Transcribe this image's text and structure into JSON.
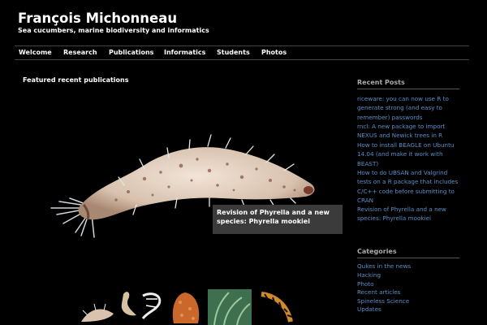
{
  "site": {
    "title": "François Michonneau",
    "tagline": "Sea cucumbers, marine biodiversity and informatics"
  },
  "nav": {
    "items": [
      {
        "label": "Welcome"
      },
      {
        "label": "Research"
      },
      {
        "label": "Publications"
      },
      {
        "label": "Informatics"
      },
      {
        "label": "Students"
      },
      {
        "label": "Photos"
      }
    ]
  },
  "featured": {
    "heading": "Featured recent publications",
    "caption": "Revision of Phyrella and a new species: Phyrella mookiei"
  },
  "sidebar": {
    "recent_posts": {
      "heading": "Recent Posts",
      "items": [
        {
          "label": "riceware: you can now use R to generate strong (and easy to remember) passwords"
        },
        {
          "label": "rncl: A new package to import NEXUS and Newick trees in R"
        },
        {
          "label": "How to install BEAGLE on Ubuntu 14.04 (and make it work with BEAST)"
        },
        {
          "label": "How to do UBSAN and Valgrind tests on a R package that includes C/C++ code before submitting to CRAN"
        },
        {
          "label": "Revision of Phyrella and a new species: Phyrella mookiei"
        }
      ]
    },
    "categories": {
      "heading": "Categories",
      "items": [
        {
          "label": "Qukes in the news"
        },
        {
          "label": "Hacking"
        },
        {
          "label": "Photo"
        },
        {
          "label": "Recent articles"
        },
        {
          "label": "Spineless Science"
        },
        {
          "label": "Updates"
        }
      ]
    }
  },
  "colors": {
    "background": "#000000",
    "link": "#5a8fc6",
    "caption_bg": "#3b3b3b",
    "sidebar_heading": "#aaaaaa"
  }
}
